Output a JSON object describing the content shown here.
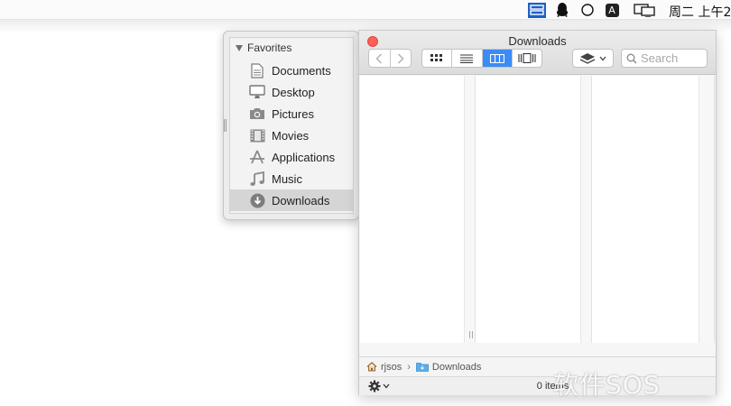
{
  "menubar": {
    "clock": "周二 上午2",
    "icons": [
      "window-list-icon",
      "qq-penguin-icon",
      "circle-icon",
      "input-source-icon",
      "display-mirroring-icon"
    ],
    "input_source_letter": "A"
  },
  "sidebar": {
    "section": "Favorites",
    "items": [
      {
        "label": "Documents",
        "icon": "document-icon"
      },
      {
        "label": "Desktop",
        "icon": "desktop-icon"
      },
      {
        "label": "Pictures",
        "icon": "camera-icon"
      },
      {
        "label": "Movies",
        "icon": "film-icon"
      },
      {
        "label": "Applications",
        "icon": "applications-icon"
      },
      {
        "label": "Music",
        "icon": "music-note-icon"
      },
      {
        "label": "Downloads",
        "icon": "download-icon",
        "selected": true
      }
    ]
  },
  "window": {
    "title": "Downloads",
    "search_placeholder": "Search",
    "view_mode": "columns",
    "accent": "#3b8bf6"
  },
  "pathbar": {
    "segments": [
      "rjsos",
      "Downloads"
    ]
  },
  "status": {
    "items_text": "0 items"
  },
  "watermark": "软件SOS"
}
